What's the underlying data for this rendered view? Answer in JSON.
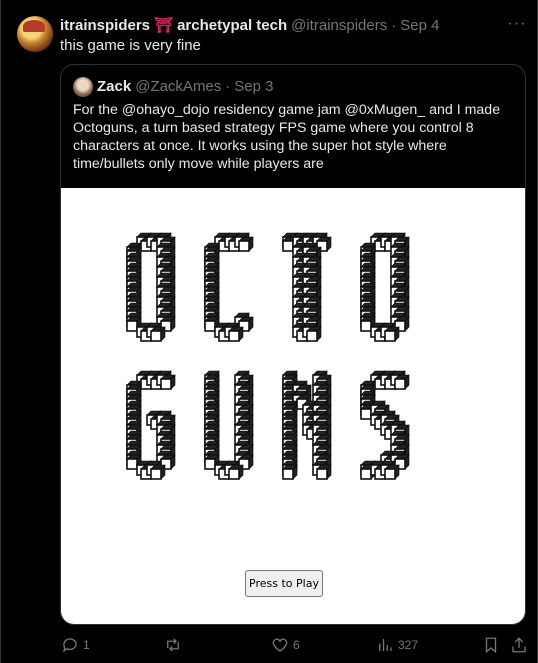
{
  "tweet": {
    "display_name": "itrainspiders",
    "badge_glyph": "⛩",
    "name_suffix": "archetypal tech",
    "handle": "@itrainspiders",
    "separator": "·",
    "date": "Sep 4",
    "more_glyph": "···",
    "text": "this game is very fine"
  },
  "quote": {
    "display_name": "Zack",
    "handle": "@ZackAmes",
    "separator": "·",
    "date": "Sep 3",
    "text": "For the @ohayo_dojo residency game jam @0xMugen_ and I made Octoguns, a turn based strategy FPS game where you control 8 characters at once. It works using the super hot style where time/bullets only move while players are",
    "media": {
      "logo_text": "OCTOGUNS",
      "button_label": "Press to Play"
    }
  },
  "actions": {
    "replies": "1",
    "retweets": "",
    "likes": "6",
    "views": "327"
  },
  "icons": [
    "more-icon",
    "reply-icon",
    "retweet-icon",
    "like-icon",
    "views-icon",
    "bookmark-icon",
    "share-icon"
  ],
  "colors": {
    "background": "#000000",
    "text": "#e7e9ea",
    "secondary": "#71767b",
    "border": "#2f3336",
    "badge": "#e0245e"
  }
}
